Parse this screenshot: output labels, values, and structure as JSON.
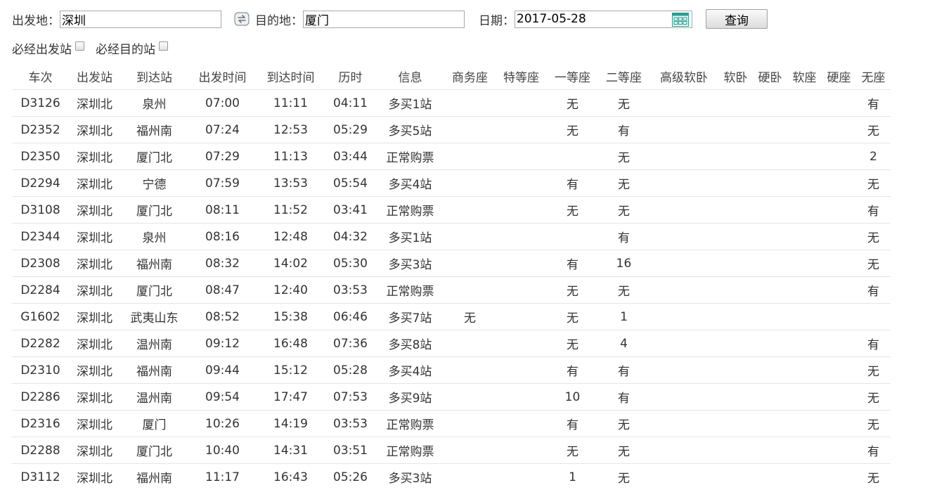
{
  "search": {
    "from_label": "出发地：",
    "from_value": "深圳",
    "to_label": "目的地：",
    "to_value": "厦门",
    "date_label": "日期：",
    "date_value": "2017-05-28",
    "query_button": "查询"
  },
  "filters": {
    "via_departure_label": "必经出发站",
    "via_destination_label": "必经目的站"
  },
  "table": {
    "columns": [
      "车次",
      "出发站",
      "到达站",
      "出发时间",
      "到达时间",
      "历时",
      "信息",
      "商务座",
      "特等座",
      "一等座",
      "二等座",
      "高级软卧",
      "软卧",
      "硬卧",
      "软座",
      "硬座",
      "无座"
    ],
    "rows": [
      [
        "D3126",
        "深圳北",
        "泉州",
        "07:00",
        "11:11",
        "04:11",
        "多买1站",
        "",
        "",
        "无",
        "无",
        "",
        "",
        "",
        "",
        "",
        "有"
      ],
      [
        "D2352",
        "深圳北",
        "福州南",
        "07:24",
        "12:53",
        "05:29",
        "多买5站",
        "",
        "",
        "无",
        "有",
        "",
        "",
        "",
        "",
        "",
        "无"
      ],
      [
        "D2350",
        "深圳北",
        "厦门北",
        "07:29",
        "11:13",
        "03:44",
        "正常购票",
        "",
        "",
        "",
        "无",
        "",
        "",
        "",
        "",
        "",
        "2"
      ],
      [
        "D2294",
        "深圳北",
        "宁德",
        "07:59",
        "13:53",
        "05:54",
        "多买4站",
        "",
        "",
        "有",
        "无",
        "",
        "",
        "",
        "",
        "",
        "无"
      ],
      [
        "D3108",
        "深圳北",
        "厦门北",
        "08:11",
        "11:52",
        "03:41",
        "正常购票",
        "",
        "",
        "无",
        "无",
        "",
        "",
        "",
        "",
        "",
        "有"
      ],
      [
        "D2344",
        "深圳北",
        "泉州",
        "08:16",
        "12:48",
        "04:32",
        "多买1站",
        "",
        "",
        "",
        "有",
        "",
        "",
        "",
        "",
        "",
        "无"
      ],
      [
        "D2308",
        "深圳北",
        "福州南",
        "08:32",
        "14:02",
        "05:30",
        "多买3站",
        "",
        "",
        "有",
        "16",
        "",
        "",
        "",
        "",
        "",
        "无"
      ],
      [
        "D2284",
        "深圳北",
        "厦门北",
        "08:47",
        "12:40",
        "03:53",
        "正常购票",
        "",
        "",
        "无",
        "无",
        "",
        "",
        "",
        "",
        "",
        "有"
      ],
      [
        "G1602",
        "深圳北",
        "武夷山东",
        "08:52",
        "15:38",
        "06:46",
        "多买7站",
        "无",
        "",
        "无",
        "1",
        "",
        "",
        "",
        "",
        "",
        ""
      ],
      [
        "D2282",
        "深圳北",
        "温州南",
        "09:12",
        "16:48",
        "07:36",
        "多买8站",
        "",
        "",
        "无",
        "4",
        "",
        "",
        "",
        "",
        "",
        "有"
      ],
      [
        "D2310",
        "深圳北",
        "福州南",
        "09:44",
        "15:12",
        "05:28",
        "多买4站",
        "",
        "",
        "有",
        "有",
        "",
        "",
        "",
        "",
        "",
        "无"
      ],
      [
        "D2286",
        "深圳北",
        "温州南",
        "09:54",
        "17:47",
        "07:53",
        "多买9站",
        "",
        "",
        "10",
        "有",
        "",
        "",
        "",
        "",
        "",
        "无"
      ],
      [
        "D2316",
        "深圳北",
        "厦门",
        "10:26",
        "14:19",
        "03:53",
        "正常购票",
        "",
        "",
        "有",
        "无",
        "",
        "",
        "",
        "",
        "",
        "无"
      ],
      [
        "D2288",
        "深圳北",
        "厦门北",
        "10:40",
        "14:31",
        "03:51",
        "正常购票",
        "",
        "",
        "无",
        "无",
        "",
        "",
        "",
        "",
        "",
        "有"
      ],
      [
        "D3112",
        "深圳北",
        "福州南",
        "11:17",
        "16:43",
        "05:26",
        "多买3站",
        "",
        "",
        "1",
        "无",
        "",
        "",
        "",
        "",
        "",
        "无"
      ]
    ]
  },
  "icons": {
    "swap": "swap-arrows-icon",
    "calendar": "calendar-icon"
  },
  "colors": {
    "calendar_accent": "#2a9d8f",
    "row_divider": "#e6e6e6"
  }
}
